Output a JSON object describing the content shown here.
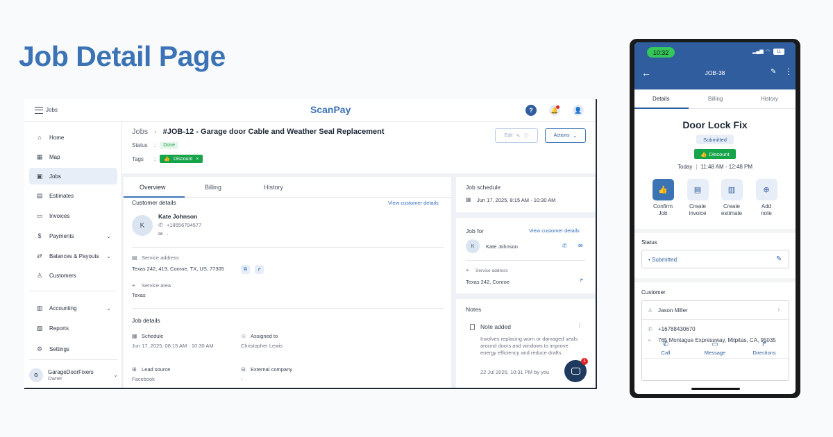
{
  "hero_title": "Job Detail Page",
  "colors": {
    "accent": "#3b73b5",
    "success": "#16a34a",
    "nav_dark": "#2f5d9e"
  },
  "desktop": {
    "menu_label": "Jobs",
    "brand": "ScanPay",
    "sidebar": {
      "items": [
        {
          "label": "Home",
          "icon": "home-icon"
        },
        {
          "label": "Map",
          "icon": "map-icon"
        },
        {
          "label": "Jobs",
          "icon": "briefcase-icon",
          "active": true
        },
        {
          "label": "Estimates",
          "icon": "estimate-icon"
        },
        {
          "label": "Invoices",
          "icon": "invoice-icon"
        },
        {
          "label": "Payments",
          "icon": "payments-icon"
        },
        {
          "label": "Balances & Payouts",
          "icon": "balance-icon"
        },
        {
          "label": "Customers",
          "icon": "customer-icon"
        },
        {
          "label": "Accounting",
          "icon": "accounting-icon"
        },
        {
          "label": "Reports",
          "icon": "reports-icon"
        },
        {
          "label": "Settings",
          "icon": "settings-icon"
        }
      ],
      "account": {
        "initial": "G",
        "name": "GarageDoorFixers",
        "role": "Owner"
      }
    },
    "job": {
      "breadcrumb_root": "Jobs",
      "title": "#JOB-12 - Garage door Cable and Weather Seal Replacement",
      "status_label": "Status",
      "status": "Done",
      "tags_label": "Tags",
      "tag": "Discount",
      "edit_label": "Edit",
      "actions_label": "Actions"
    },
    "tabs": [
      "Overview",
      "Billing",
      "History"
    ],
    "customer_details": {
      "title": "Customer details",
      "link": "View customer details",
      "initial": "K",
      "name": "Kate Johnson",
      "phone": "+18556794577",
      "email": "-",
      "service_address_label": "Service address",
      "service_address": "Texas 242, 419, Conroe, TX, US, 77305",
      "service_area_label": "Service area",
      "service_area": "Texas"
    },
    "job_details": {
      "title": "Job details",
      "schedule_label": "Schedule",
      "schedule": "Jun 17, 2025, 08:15 AM - 10:30 AM",
      "assigned_label": "Assigned to",
      "assigned": "Christopher Lewis",
      "lead_source_label": "Lead source",
      "lead_source": "Facebook",
      "external_company_label": "External company",
      "external_company": "-"
    },
    "job_schedule": {
      "title": "Job schedule",
      "value": "Jun 17, 2025, 8:15 AM - 10:30 AM"
    },
    "job_for": {
      "title": "Job for",
      "link": "View customer details",
      "initial": "K",
      "name": "Kate Johnson",
      "service_address_label": "Service address",
      "service_address": "Texas 242, Conroe"
    },
    "notes": {
      "title": "Notes",
      "note_title": "Note added",
      "note_body": "Involves replacing worn or damaged seals around doors and windows to improve energy efficiency and reduce drafts",
      "note_meta": "22 Jul 2025, 10:31 PM by you",
      "chat_badge": "1"
    }
  },
  "phone": {
    "time": "10:32",
    "battery": "11",
    "header_title": "JOB-38",
    "tabs": [
      "Details",
      "Billing",
      "History"
    ],
    "title": "Door Lock Fix",
    "status": "Submitted",
    "tag": "Discount",
    "date": "Today",
    "time_range": "11:48 AM - 12:48 PM",
    "quick_actions": [
      {
        "line1": "Confirm",
        "line2": "Job",
        "icon": "thumbs-up-icon"
      },
      {
        "line1": "Create",
        "line2": "invoice",
        "icon": "invoice-icon"
      },
      {
        "line1": "Create",
        "line2": "estimate",
        "icon": "estimate-icon"
      },
      {
        "line1": "Add",
        "line2": "note",
        "icon": "add-note-icon"
      }
    ],
    "status_section": {
      "title": "Status",
      "value": "• Submitted"
    },
    "customer_section": {
      "title": "Customer",
      "name": "Jason Miller",
      "phone": "+16788430670",
      "address": "765 Montague Expressway, Milpitas, CA, 95035"
    },
    "contact_actions": [
      "Call",
      "Message",
      "Directions"
    ]
  }
}
